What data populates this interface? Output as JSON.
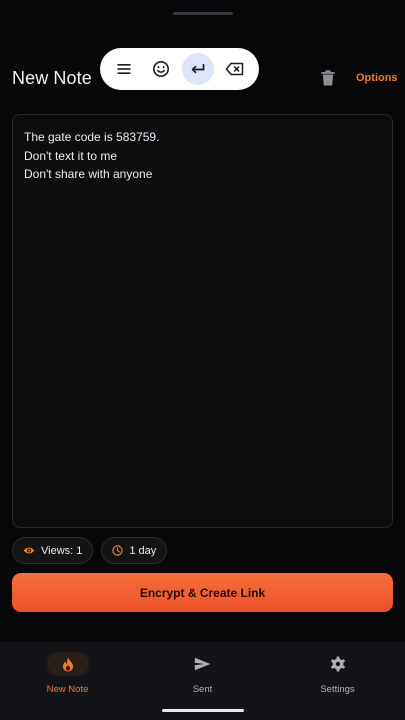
{
  "header": {
    "title": "New Note",
    "options_label": "Options"
  },
  "keyboard_toolbar": {
    "buttons": [
      "menu-icon",
      "emoji-icon",
      "enter-icon",
      "backspace-icon"
    ],
    "active": "enter-icon"
  },
  "note": {
    "lines": [
      "The gate code is 583759.",
      "Don't text it to me",
      "Don't share with anyone"
    ]
  },
  "settings_chips": {
    "views": "Views: 1",
    "expiry": "1 day"
  },
  "primary_action": {
    "label": "Encrypt & Create Link"
  },
  "bottom_nav": {
    "items": [
      {
        "label": "New Note",
        "icon": "flame-icon",
        "active": true
      },
      {
        "label": "Sent",
        "icon": "send-icon",
        "active": false
      },
      {
        "label": "Settings",
        "icon": "gear-icon",
        "active": false
      }
    ]
  },
  "colors": {
    "accent": "#f07a2a",
    "background": "#08080a",
    "cta_gradient_top": "#f4703a",
    "cta_gradient_bottom": "#ee4f2a"
  }
}
